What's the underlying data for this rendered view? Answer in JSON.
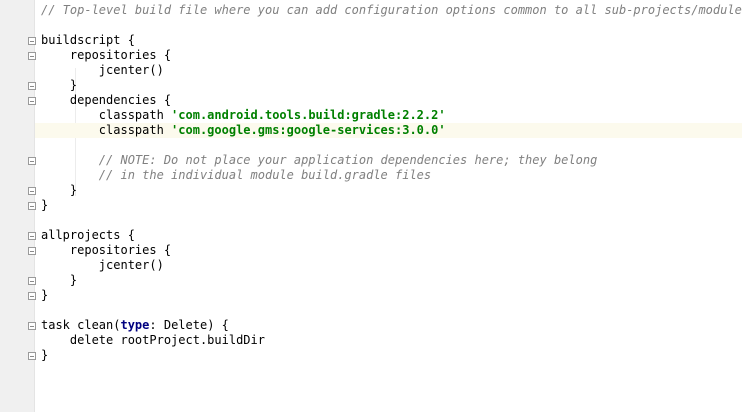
{
  "editor": {
    "current_line_color": "#fcfaed",
    "comment_color": "#808080",
    "string_color": "#008000",
    "keyword_color": "#000080",
    "lines": [
      [
        {
          "t": "// Top-level build file where you can add configuration options common to all sub-projects/modules.",
          "c": "comment"
        }
      ],
      [],
      [
        {
          "t": "buildscript {",
          "c": ""
        }
      ],
      [
        {
          "t": "    repositories {",
          "c": ""
        }
      ],
      [
        {
          "t": "        jcenter()",
          "c": ""
        }
      ],
      [
        {
          "t": "    }",
          "c": ""
        }
      ],
      [
        {
          "t": "    dependencies {",
          "c": ""
        }
      ],
      [
        {
          "t": "        classpath ",
          "c": ""
        },
        {
          "t": "'com.android.tools.build:gradle:2.2.2'",
          "c": "string"
        }
      ],
      [
        {
          "t": "        classpath ",
          "c": ""
        },
        {
          "t": "'com.google.gms:google-services:3.0.0'",
          "c": "string"
        }
      ],
      [],
      [
        {
          "t": "        // NOTE: Do not place your application dependencies here; they belong",
          "c": "comment"
        }
      ],
      [
        {
          "t": "        // in the individual module build.gradle files",
          "c": "comment"
        }
      ],
      [
        {
          "t": "    }",
          "c": ""
        }
      ],
      [
        {
          "t": "}",
          "c": ""
        }
      ],
      [],
      [
        {
          "t": "allprojects {",
          "c": ""
        }
      ],
      [
        {
          "t": "    repositories {",
          "c": ""
        }
      ],
      [
        {
          "t": "        jcenter()",
          "c": ""
        }
      ],
      [
        {
          "t": "    }",
          "c": ""
        }
      ],
      [
        {
          "t": "}",
          "c": ""
        }
      ],
      [],
      [
        {
          "t": "task clean(",
          "c": ""
        },
        {
          "t": "type",
          "c": "kw"
        },
        {
          "t": ": Delete) {",
          "c": ""
        }
      ],
      [
        {
          "t": "    delete rootProject.buildDir",
          "c": ""
        }
      ],
      [
        {
          "t": "}",
          "c": ""
        }
      ]
    ],
    "current_line_index": 8,
    "fold_lines": [
      2,
      3,
      5,
      6,
      10,
      12,
      13,
      15,
      16,
      18,
      19,
      21,
      23
    ]
  }
}
